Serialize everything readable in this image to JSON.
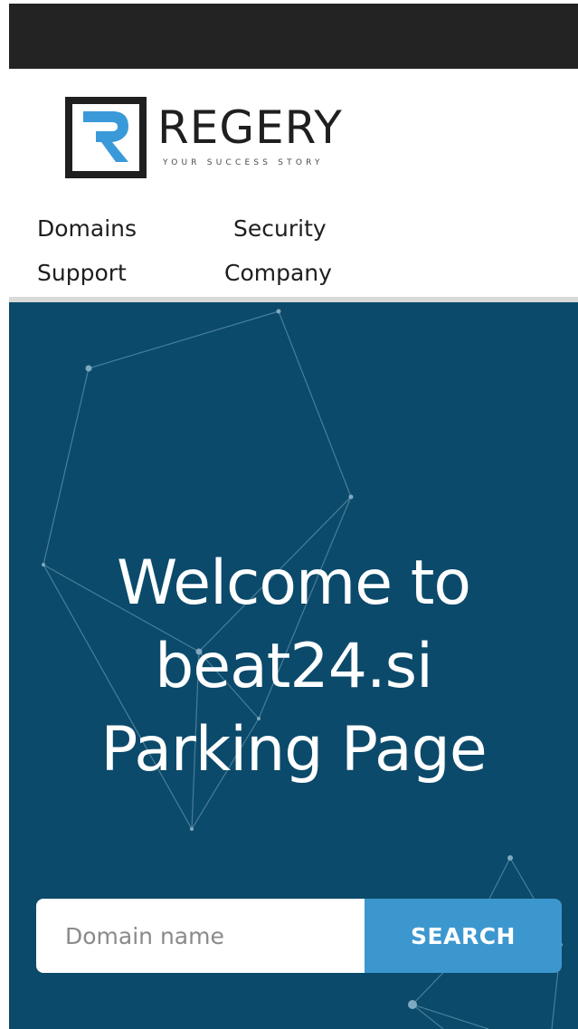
{
  "brand": {
    "name": "REGERY",
    "tagline": "YOUR SUCCESS STORY",
    "mark_letter": "R"
  },
  "nav": {
    "items": [
      {
        "label": "Domains"
      },
      {
        "label": "Security"
      },
      {
        "label": "Support"
      },
      {
        "label": "Company"
      }
    ]
  },
  "hero": {
    "title_lines": [
      "Welcome to",
      "beat24.si",
      "Parking Page"
    ]
  },
  "search": {
    "placeholder": "Domain name",
    "value": "",
    "button_label": "SEARCH"
  },
  "colors": {
    "top_bar": "#232323",
    "hero_background": "#0b4a6b",
    "accent": "#3d97cf",
    "logo_blue": "#3a9ad9",
    "logo_dark": "#1f1f1f"
  },
  "icons": {
    "logo_mark": "regery-r-logo-icon"
  }
}
